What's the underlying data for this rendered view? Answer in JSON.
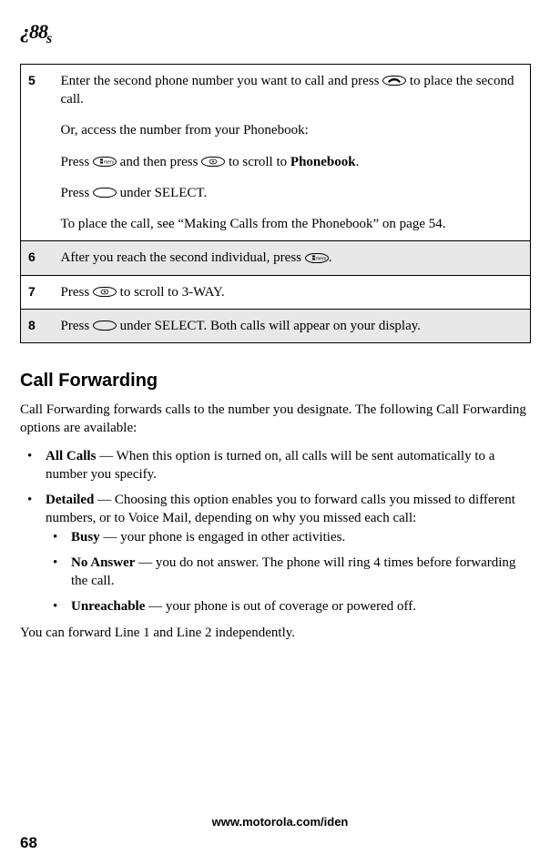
{
  "logo": {
    "main": "¿88",
    "suffix": "s"
  },
  "steps": [
    {
      "num": "5",
      "shaded": false,
      "paragraphs": [
        {
          "pre": "Enter the second phone number you want to call and press ",
          "icon": "phone-icon",
          "post": " to place the second call."
        },
        {
          "text": "Or, access the number from your Phonebook:"
        },
        {
          "pre": "Press ",
          "icon": "menu-icon",
          "mid": " and then press ",
          "icon2": "nav-icon",
          "post": " to scroll to ",
          "bold": "Phonebook",
          "tail": "."
        },
        {
          "pre": "Press ",
          "icon": "blank-icon",
          "post": " under SELECT."
        },
        {
          "text": "To place the call, see “Making Calls from the Phonebook” on page 54."
        }
      ]
    },
    {
      "num": "6",
      "shaded": true,
      "paragraphs": [
        {
          "pre": "After you reach the second individual, press ",
          "icon": "menu-icon",
          "post": "."
        }
      ]
    },
    {
      "num": "7",
      "shaded": false,
      "paragraphs": [
        {
          "pre": "Press ",
          "icon": "nav-icon",
          "post": " to scroll to 3-WAY."
        }
      ]
    },
    {
      "num": "8",
      "shaded": true,
      "paragraphs": [
        {
          "pre": "Press ",
          "icon": "blank-icon",
          "post": " under SELECT. Both calls will appear on your display."
        }
      ]
    }
  ],
  "section_heading": "Call Forwarding",
  "intro_para": "Call Forwarding forwards calls to the number you designate. The following Call Forwarding options are available:",
  "bullets": [
    {
      "bold": "All Calls",
      "rest": " — When this option is turned on, all calls will be sent automatically to a number you specify."
    },
    {
      "bold": "Detailed",
      "rest": " — Choosing this option enables you to forward calls you missed to different numbers, or to Voice Mail, depending on why you missed each call:",
      "sub": [
        {
          "bold": "Busy",
          "rest": " — your phone is engaged in other activities."
        },
        {
          "bold": "No Answer",
          "rest": " — you do not answer. The phone will ring 4 times before forwarding the call."
        },
        {
          "bold": "Unreachable",
          "rest": " — your phone is out of coverage or powered off."
        }
      ]
    }
  ],
  "closing_para": "You can forward Line 1 and Line 2 independently.",
  "footer_url": "www.motorola.com/iden",
  "page_number": "68",
  "icon_labels": {
    "menu-icon": "",
    "nav-icon": "",
    "blank-icon": "",
    "phone-icon": ""
  }
}
